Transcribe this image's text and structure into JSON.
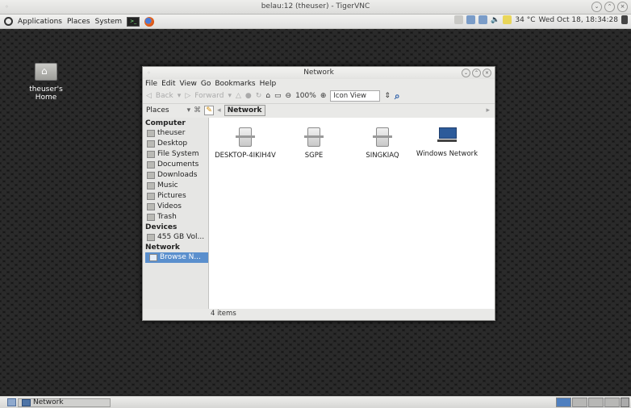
{
  "vnc_window": {
    "title": "belau:12 (theuser) - TigerVNC"
  },
  "top_panel": {
    "menus": [
      "Applications",
      "Places",
      "System"
    ],
    "status": {
      "temperature": "34 °C",
      "datetime": "Wed Oct 18, 18:34:28"
    }
  },
  "desktop": {
    "home_icon_label": "theuser's Home"
  },
  "file_manager": {
    "title": "Network",
    "menubar": [
      "File",
      "Edit",
      "View",
      "Go",
      "Bookmarks",
      "Help"
    ],
    "toolbar": {
      "back_label": "Back",
      "forward_label": "Forward",
      "zoom": "100%",
      "view_mode": "Icon View"
    },
    "location": {
      "side_pane_label": "Places",
      "crumb": "Network"
    },
    "sidebar": {
      "sections": [
        {
          "header": "Computer",
          "items": [
            "theuser",
            "Desktop",
            "File System",
            "Documents",
            "Downloads",
            "Music",
            "Pictures",
            "Videos",
            "Trash"
          ]
        },
        {
          "header": "Devices",
          "items": [
            "455 GB Vol..."
          ]
        },
        {
          "header": "Network",
          "items": [
            "Browse N..."
          ]
        }
      ],
      "selected": "Browse N..."
    },
    "items": [
      {
        "name": "DESKTOP-4IKIH4V",
        "icon": "server-icon"
      },
      {
        "name": "SGPE",
        "icon": "server-icon"
      },
      {
        "name": "SINGKIAQ",
        "icon": "server-icon"
      },
      {
        "name": "Windows Network",
        "icon": "network-icon"
      }
    ],
    "status": "4 items"
  },
  "taskbar": {
    "window_button": "Network"
  }
}
